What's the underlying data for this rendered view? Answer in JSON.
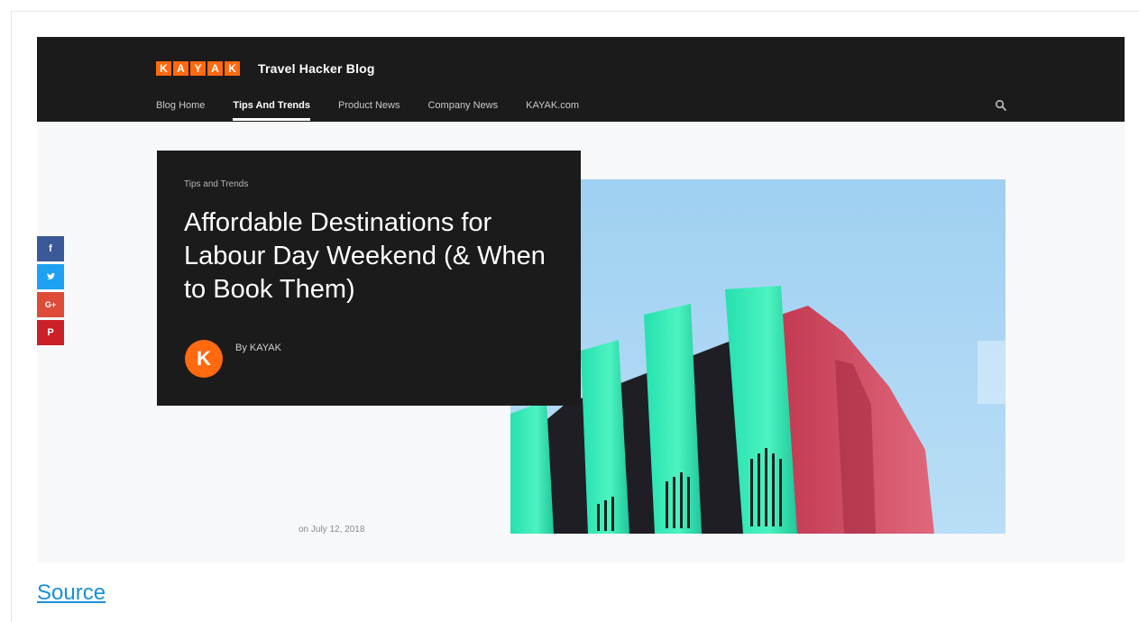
{
  "header": {
    "logo_letters": [
      "K",
      "A",
      "Y",
      "A",
      "K"
    ],
    "blog_title": "Travel Hacker Blog",
    "nav": [
      {
        "label": "Blog Home",
        "active": false
      },
      {
        "label": "Tips And Trends",
        "active": true
      },
      {
        "label": "Product News",
        "active": false
      },
      {
        "label": "Company News",
        "active": false
      },
      {
        "label": "KAYAK.com",
        "active": false
      }
    ],
    "search_icon": "search-icon"
  },
  "article": {
    "category": "Tips and Trends",
    "title": "Affordable Destinations for Labour Day Weekend (& When to Book Them)",
    "avatar_letter": "K",
    "author": "By KAYAK",
    "date": "on July 12, 2018"
  },
  "share": {
    "facebook": "f",
    "twitter": "t",
    "googleplus": "G+",
    "pinterest": "P"
  },
  "footer": {
    "source_link": "Source"
  },
  "colors": {
    "brand_orange": "#ff690f",
    "nav_bg": "#1b1b1b",
    "facebook": "#3b5998",
    "twitter": "#1da1f2",
    "googleplus": "#dd4b39",
    "pinterest": "#cb2027",
    "link": "#1a8fd6"
  }
}
